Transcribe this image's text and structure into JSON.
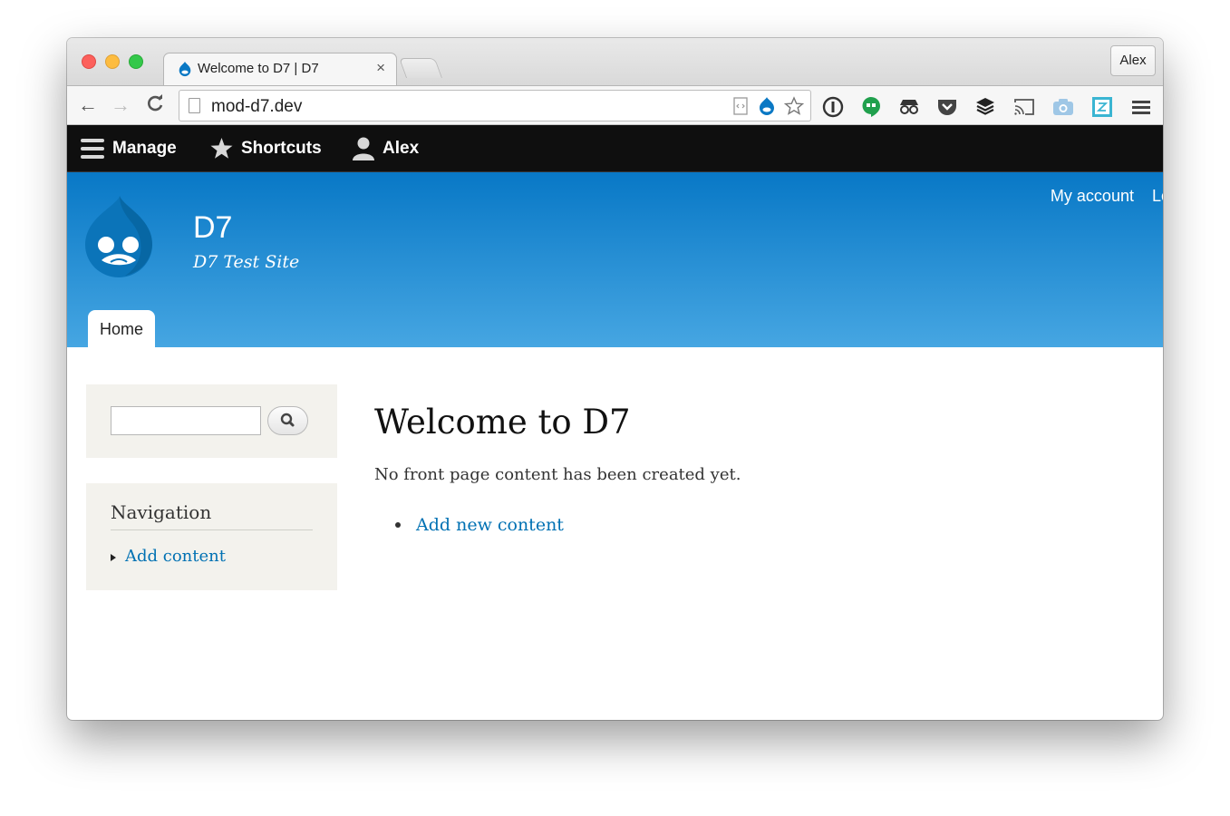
{
  "browser": {
    "tab_title": "Welcome to D7 | D7",
    "tab_close": "×",
    "profile_name": "Alex",
    "url": "mod-d7.dev",
    "nav": {
      "back": "←",
      "forward": "→",
      "reload": "C"
    }
  },
  "admin_toolbar": {
    "manage": "Manage",
    "shortcuts": "Shortcuts",
    "user": "Alex"
  },
  "header": {
    "site_name": "D7",
    "slogan": "D7 Test Site",
    "links": [
      "My account",
      "Lo"
    ],
    "tabs": [
      "Home"
    ]
  },
  "sidebar": {
    "navigation_title": "Navigation",
    "navigation_items": [
      "Add content"
    ]
  },
  "main": {
    "title": "Welcome to D7",
    "message": "No front page content has been created yet.",
    "links": [
      "Add new content"
    ]
  },
  "colors": {
    "admin_bar": "#0f0f0f",
    "header_top": "#0878c6",
    "header_bottom": "#46a6e2",
    "link": "#0071b3",
    "block_bg": "#f3f2ed"
  }
}
